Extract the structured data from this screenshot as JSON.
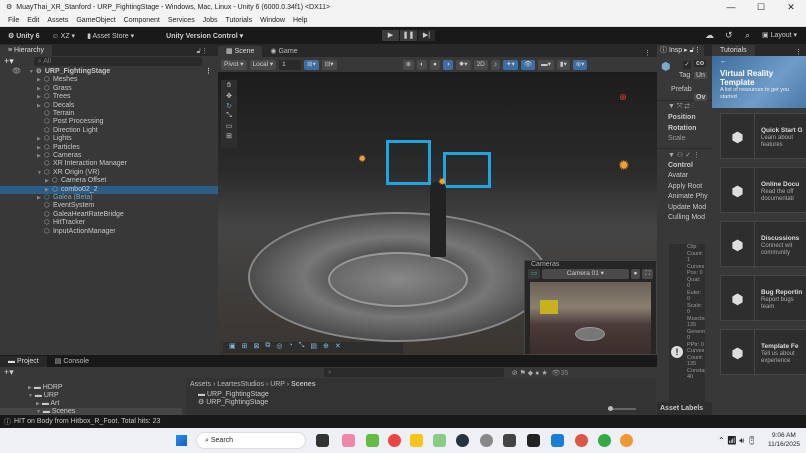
{
  "window": {
    "title": "MuayThai_XR_Stanford - URP_FightingStage - Windows, Mac, Linux - Unity 6 (6000.0.34f1) <DX11>",
    "controls": [
      "—",
      "☐",
      "✕"
    ]
  },
  "menu": [
    "File",
    "Edit",
    "Assets",
    "GameObject",
    "Component",
    "Services",
    "Jobs",
    "Tutorials",
    "Window",
    "Help"
  ],
  "toolbar": {
    "unity": "Unity 6",
    "account": "XZ ▾",
    "asset_store": "Asset Store ▾",
    "version_control": "Unity Version Control ▾",
    "layout": "Layout ▾",
    "play": [
      "▶",
      "❚❚",
      "▶|"
    ]
  },
  "hierarchy": {
    "tab": "Hierarchy",
    "search_placeholder": "All",
    "root": "URP_FightingStage",
    "items": [
      {
        "label": "Meshes",
        "depth": 1,
        "arrow": "▶"
      },
      {
        "label": "Grass",
        "depth": 1,
        "arrow": "▶"
      },
      {
        "label": "Trees",
        "depth": 1,
        "arrow": "▶"
      },
      {
        "label": "Decals",
        "depth": 1,
        "arrow": "▶"
      },
      {
        "label": "Terrain",
        "depth": 1,
        "arrow": ""
      },
      {
        "label": "Post Processing",
        "depth": 1,
        "arrow": ""
      },
      {
        "label": "Direction Light",
        "depth": 1,
        "arrow": ""
      },
      {
        "label": "Lights",
        "depth": 1,
        "arrow": "▶"
      },
      {
        "label": "Particles",
        "depth": 1,
        "arrow": "▶"
      },
      {
        "label": "Cameras",
        "depth": 1,
        "arrow": "▶"
      },
      {
        "label": "XR Interaction Manager",
        "depth": 1,
        "arrow": ""
      },
      {
        "label": "XR Origin (VR)",
        "depth": 1,
        "arrow": "▼"
      },
      {
        "label": "Camera Offset",
        "depth": 2,
        "arrow": "▶"
      },
      {
        "label": "combo02_2",
        "depth": 2,
        "arrow": "▶",
        "selected": true
      },
      {
        "label": "Galea (Beta)",
        "depth": 1,
        "arrow": "▶",
        "prefab": true
      },
      {
        "label": "EventSystem",
        "depth": 1,
        "arrow": ""
      },
      {
        "label": "GaleaHeartRateBridge",
        "depth": 1,
        "arrow": ""
      },
      {
        "label": "HitTracker",
        "depth": 1,
        "arrow": ""
      },
      {
        "label": "InputActionManager",
        "depth": 1,
        "arrow": ""
      }
    ]
  },
  "scene": {
    "tabs": [
      "Scene",
      "Game"
    ],
    "pivot": "Pivot ▾",
    "local": "Local ▾",
    "grid_value": "1",
    "camera_overlay": {
      "title": "Cameras",
      "camera": "Camera 01 ▾"
    }
  },
  "inspector": {
    "tab": "Insp",
    "name": "co",
    "tag_label": "Tag",
    "tag_value": "Un",
    "prefab_label": "Prefab",
    "overrides": "Ov",
    "transform": [
      "Position",
      "Rotation",
      "Scale"
    ],
    "animator": [
      "Control",
      "Avatar",
      "Apply Root",
      "Animate Phy",
      "Update Mod",
      "Culling Mod"
    ],
    "clip_info": [
      "Clip Count: 1",
      "Curves Pos: 0",
      "Quat: 0",
      "Euler: 0",
      "Scale: 0",
      "Muscles: 135",
      "Generic: 0",
      "PPtr: 0",
      "Curves Count: 135",
      "Constant: 40"
    ],
    "asset_labels": "Asset Labels"
  },
  "tutorials": {
    "tab": "Tutorials",
    "banner_title": "Virtual Reality Template",
    "banner_sub": "A list of resources to get you started",
    "cards": [
      {
        "title": "Quick Start G",
        "desc": "Learn about\nfeatures"
      },
      {
        "title": "Online Docu",
        "desc": "Read the off\ndocumentati"
      },
      {
        "title": "Discussions",
        "desc": "Connect wit\ncommunity"
      },
      {
        "title": "Bug Reportin",
        "desc": "Report bugs\nteam"
      },
      {
        "title": "Template Fe",
        "desc": "Tell us about\nexperience"
      }
    ]
  },
  "project": {
    "tabs": [
      "Project",
      "Console"
    ],
    "tree": [
      "HDRP",
      "URP",
      "Art",
      "Scenes"
    ],
    "breadcrumb": [
      "Assets",
      "LeartesStudios",
      "URP",
      "Scenes"
    ],
    "files": [
      "URP_FightingStage",
      "URP_FightingStage"
    ],
    "count": "35"
  },
  "status": {
    "message": "HIT on Body from Hitbox_R_Foot. Total hits: 23"
  },
  "taskbar": {
    "search": "Search",
    "time": "9:06 AM",
    "date": "11/16/2025"
  },
  "colors": {
    "selection": "#2c5d87",
    "accent": "#3a6ea5",
    "highlight_cyan": "#1fa6e0"
  }
}
